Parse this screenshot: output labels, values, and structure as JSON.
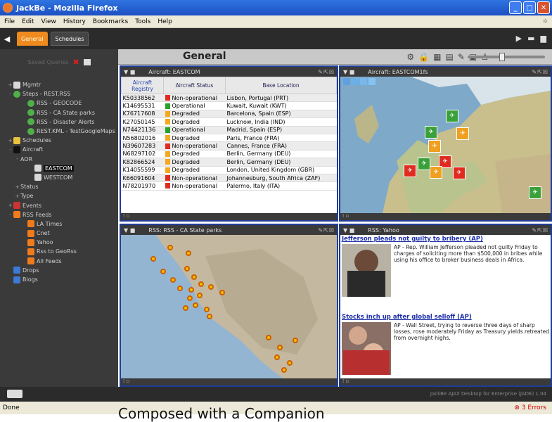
{
  "window": {
    "title": "JackBe - Mozilla Firefox"
  },
  "menu": [
    "File",
    "Edit",
    "View",
    "History",
    "Bookmarks",
    "Tools",
    "Help"
  ],
  "tabs": [
    {
      "label": "General"
    },
    {
      "label": "Schedules"
    }
  ],
  "sidebar": {
    "header": "Saved Queries",
    "tree": [
      {
        "label": "Mgmtr",
        "icon": "folder",
        "indent": 0,
        "toggle": "+"
      },
      {
        "label": "Steps - REST.RSS",
        "icon": "globe",
        "indent": 0,
        "toggle": "-"
      },
      {
        "label": "RSS - GEOCODE",
        "icon": "globe",
        "indent": 2,
        "toggle": ""
      },
      {
        "label": "RSS - CA State parks",
        "icon": "globe",
        "indent": 2,
        "toggle": ""
      },
      {
        "label": "RSS - Disaster Alerts",
        "icon": "globe",
        "indent": 2,
        "toggle": ""
      },
      {
        "label": "REST.KML - TestGoogleMaps",
        "icon": "globe",
        "indent": 2,
        "toggle": ""
      },
      {
        "label": "Schedules",
        "icon": "cal",
        "indent": 0,
        "toggle": "+"
      },
      {
        "label": "Aircraft",
        "icon": "plane",
        "indent": 0,
        "toggle": "-"
      },
      {
        "label": "AOR",
        "icon": "",
        "indent": 1,
        "toggle": "-"
      },
      {
        "label": "EASTCOM",
        "icon": "folder",
        "indent": 3,
        "toggle": "",
        "selected": true
      },
      {
        "label": "WESTCOM",
        "icon": "folder",
        "indent": 3,
        "toggle": ""
      },
      {
        "label": "Status",
        "icon": "",
        "indent": 1,
        "toggle": "+"
      },
      {
        "label": "Type",
        "icon": "",
        "indent": 1,
        "toggle": "+"
      },
      {
        "label": "Events",
        "icon": "evt",
        "indent": 0,
        "toggle": "+"
      },
      {
        "label": "RSS Feeds",
        "icon": "rss",
        "indent": 0,
        "toggle": "-"
      },
      {
        "label": "LA Times",
        "icon": "rss",
        "indent": 2,
        "toggle": ""
      },
      {
        "label": "Cnet",
        "icon": "rss",
        "indent": 2,
        "toggle": ""
      },
      {
        "label": "Yahoo",
        "icon": "rss",
        "indent": 2,
        "toggle": ""
      },
      {
        "label": "Rss to GeoRss",
        "icon": "rss",
        "indent": 2,
        "toggle": ""
      },
      {
        "label": "All Feeds",
        "icon": "rss",
        "indent": 2,
        "toggle": ""
      },
      {
        "label": "Drops",
        "icon": "blue",
        "indent": 0,
        "toggle": ""
      },
      {
        "label": "Blogs",
        "icon": "blue",
        "indent": 0,
        "toggle": ""
      }
    ]
  },
  "main": {
    "title": "General"
  },
  "panels": {
    "aircraft": {
      "title": "Aircraft: EASTCOM",
      "columns": [
        "Aircraft Registry",
        "Aircraft Status",
        "Base Location"
      ],
      "rows": [
        {
          "reg": "K50338562",
          "status": "Non-operational",
          "color": "#e02b20",
          "base": "Lisbon, Portugal (PRT)"
        },
        {
          "reg": "K14695531",
          "status": "Operational",
          "color": "#2aa12a",
          "base": "Kuwait, Kuwait (KWT)"
        },
        {
          "reg": "K76717608",
          "status": "Degraded",
          "color": "#f6a81f",
          "base": "Barcelona, Spain (ESP)"
        },
        {
          "reg": "K27050145",
          "status": "Degraded",
          "color": "#f6a81f",
          "base": "Lucknow, India (IND)"
        },
        {
          "reg": "N74421136",
          "status": "Operational",
          "color": "#2aa12a",
          "base": "Madrid, Spain (ESP)"
        },
        {
          "reg": "N56802016",
          "status": "Degraded",
          "color": "#f6a81f",
          "base": "Paris, France (FRA)"
        },
        {
          "reg": "N39607283",
          "status": "Non-operational",
          "color": "#e02b20",
          "base": "Cannes, France (FRA)"
        },
        {
          "reg": "N68297102",
          "status": "Degraded",
          "color": "#f6a81f",
          "base": "Berlin, Germany (DEU)"
        },
        {
          "reg": "K82866524",
          "status": "Degraded",
          "color": "#f6a81f",
          "base": "Berlin, Germany (DEU)"
        },
        {
          "reg": "K14055599",
          "status": "Degraded",
          "color": "#f6a81f",
          "base": "London, United Kingdom (GBR)"
        },
        {
          "reg": "K66091604",
          "status": "Non-operational",
          "color": "#e02b20",
          "base": "Johannesburg, South Africa (ZAF)"
        },
        {
          "reg": "N78201970",
          "status": "Non-operational",
          "color": "#e02b20",
          "base": "Palermo, Italy (ITA)"
        }
      ]
    },
    "map1": {
      "title": "Aircraft: EASTCOM1fs"
    },
    "parks": {
      "title": "RSS: RSS - CA State parks"
    },
    "yahoo": {
      "title": "RSS: Yahoo",
      "items": [
        {
          "headline": "Jefferson pleads not guilty to bribery (AP)",
          "body": "AP - Rep. William Jefferson pleaded not guilty Friday to charges of soliciting more than $500,000 in bribes while using his office to broker business deals in Africa."
        },
        {
          "headline": "Stocks inch up after global selloff (AP)",
          "body": "AP - Wall Street, trying to reverse three days of sharp losses, rose moderately Friday as Treasury yields retreated from overnight highs."
        }
      ]
    }
  },
  "footer": {
    "version": "JackBe AJAX Desktop for Enterprise (JADE) 1.04"
  },
  "status": {
    "left": "Done",
    "errors": "3 Errors"
  },
  "caption": "Composed with a Companion"
}
